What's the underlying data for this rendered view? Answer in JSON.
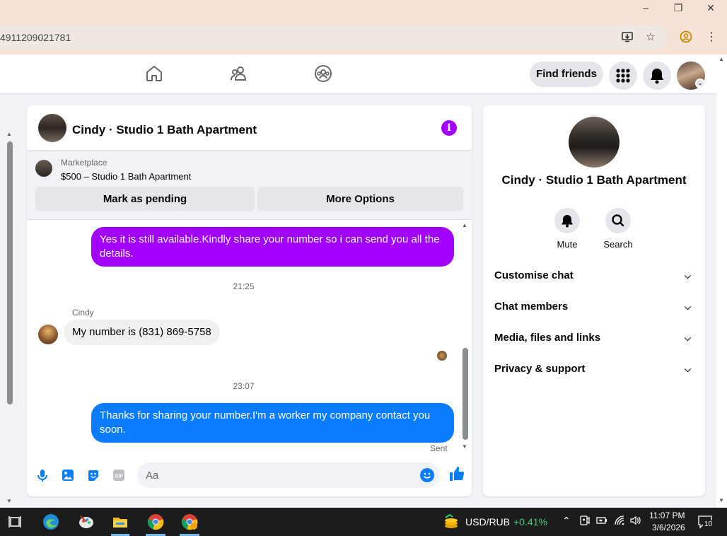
{
  "browser": {
    "url": "4911209021781",
    "window_buttons": [
      "minimize",
      "restore",
      "close"
    ]
  },
  "fbnav": {
    "find_friends_label": "Find friends",
    "icons": [
      "home-icon",
      "friends-icon",
      "groups-icon",
      "menu-grid-icon",
      "notifications-icon",
      "profile-avatar"
    ]
  },
  "chat": {
    "title": "Cindy · Studio 1 Bath Apartment",
    "marketplace": {
      "label": "Marketplace",
      "listing": "$500 – Studio 1 Bath Apartment",
      "mark_pending_label": "Mark as pending",
      "more_options_label": "More Options"
    },
    "messages": [
      {
        "direction": "out",
        "text": "Yes it is still available.Kindly share your number so i can send you all the details.",
        "color": "#a100ff"
      },
      {
        "type": "timestamp",
        "text": "21:25"
      },
      {
        "direction": "in",
        "sender": "Cindy",
        "text": "My number is (831) 869-5758"
      },
      {
        "type": "timestamp",
        "text": "23:07"
      },
      {
        "direction": "out",
        "text": "Thanks for sharing your number.I'm a worker my company contact you soon.",
        "color": "#0a7cff"
      }
    ],
    "sent_label": "Sent",
    "composer": {
      "placeholder": "Aa"
    }
  },
  "panel": {
    "title": "Cindy · Studio 1 Bath Apartment",
    "actions": [
      {
        "label": "Mute",
        "icon": "bell-icon"
      },
      {
        "label": "Search",
        "icon": "search-icon"
      }
    ],
    "sections": [
      "Customise chat",
      "Chat members",
      "Media, files and links",
      "Privacy & support"
    ]
  },
  "taskbar": {
    "ticker_name": "USD/RUB",
    "ticker_change": "+0.41%",
    "time": "11:07 PM",
    "date": "3/6/2026",
    "notification_count": "10"
  },
  "colors": {
    "outgoing_purple": "#a100ff",
    "outgoing_blue": "#0a7cff",
    "accent": "#0a7cff"
  }
}
